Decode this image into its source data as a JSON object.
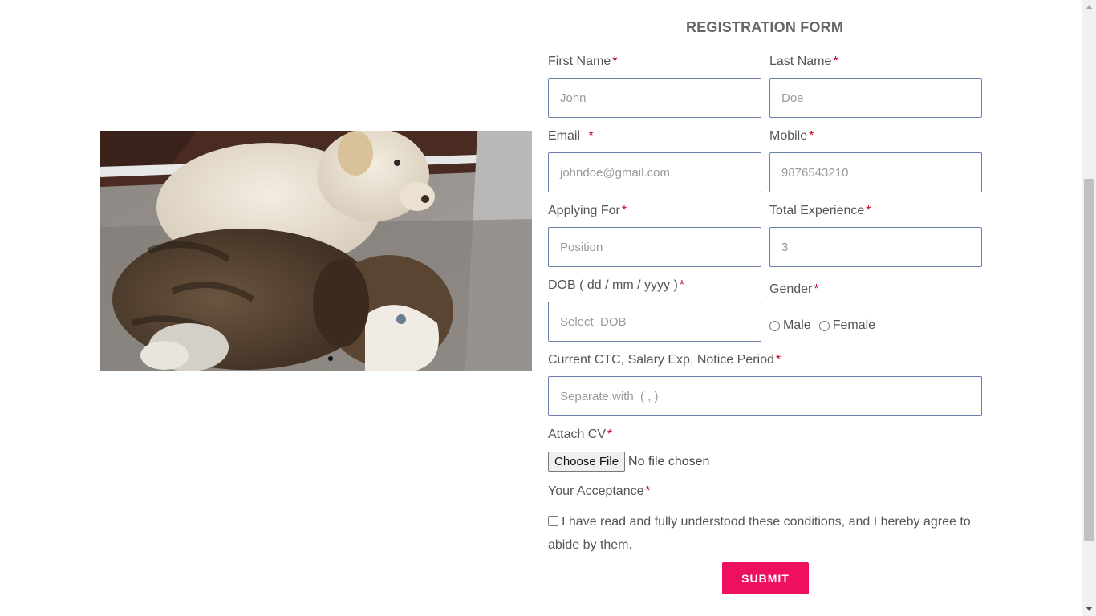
{
  "form": {
    "title": "REGISTRATION FORM",
    "required_mark": "*",
    "fields": {
      "first_name": {
        "label": "First Name",
        "placeholder": "John"
      },
      "last_name": {
        "label": "Last Name",
        "placeholder": "Doe"
      },
      "email": {
        "label": "Email ",
        "placeholder": "johndoe@gmail.com"
      },
      "mobile": {
        "label": "Mobile",
        "placeholder": "9876543210"
      },
      "applying_for": {
        "label": "Applying For",
        "placeholder": "Position"
      },
      "experience": {
        "label": "Total Experience",
        "placeholder": "3"
      },
      "dob": {
        "label": "DOB ( dd / mm / yyyy )",
        "placeholder": "Select  DOB"
      },
      "gender": {
        "label": "Gender",
        "options": [
          "Male",
          "Female"
        ]
      },
      "ctc": {
        "label": "Current CTC, Salary Exp, Notice Period",
        "placeholder": "Separate with  ( , )"
      },
      "cv": {
        "label": "Attach CV",
        "button": "Choose File",
        "status": "No file chosen"
      },
      "acceptance": {
        "label": "Your Acceptance",
        "text": "I have read and fully understood these conditions, and I hereby agree to abide by them."
      }
    },
    "submit_label": "SUBMIT"
  },
  "carousel": {
    "prev_icon": "chevron-left-icon",
    "next_icon": "chevron-right-icon",
    "active_slide": 1,
    "slide_count": 1
  },
  "colors": {
    "accent": "#ee0f5f",
    "required": "#c4001d",
    "input_border": "#6b7fa8"
  }
}
